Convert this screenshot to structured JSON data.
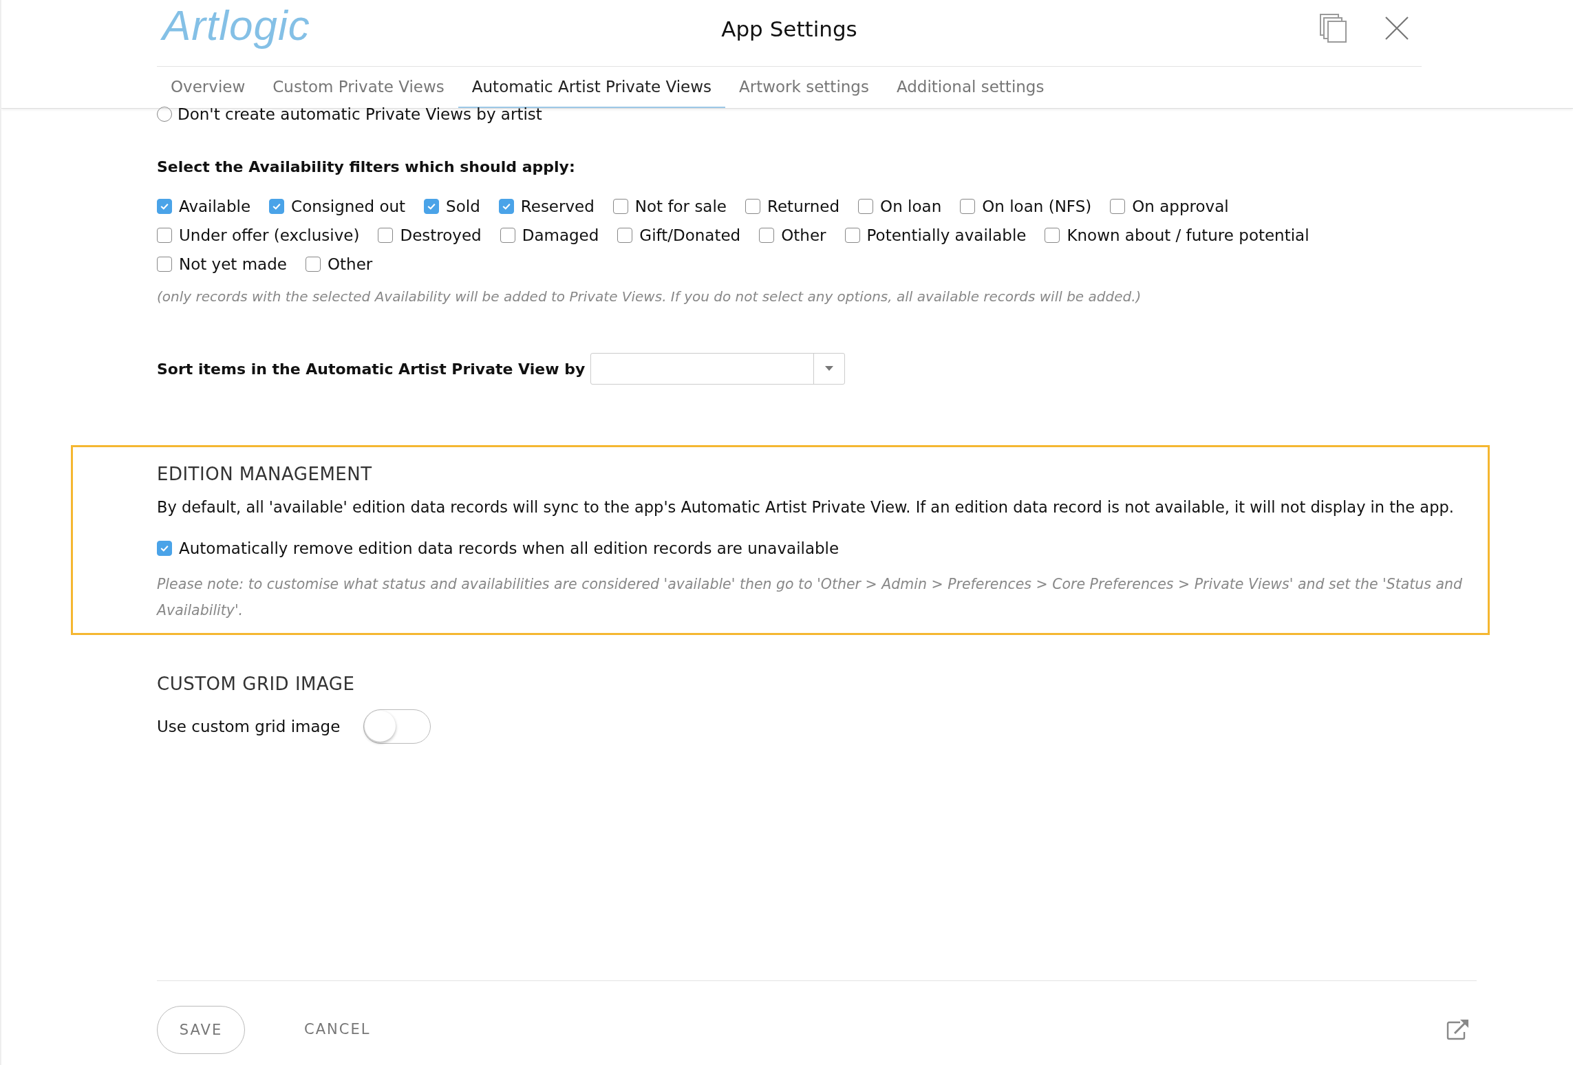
{
  "header": {
    "logo": "Artlogic",
    "title": "App Settings"
  },
  "tabs": [
    {
      "label": "Overview",
      "selected": false
    },
    {
      "label": "Custom Private Views",
      "selected": false
    },
    {
      "label": "Automatic Artist Private Views",
      "selected": true
    },
    {
      "label": "Artwork settings",
      "selected": false
    },
    {
      "label": "Additional settings",
      "selected": false
    }
  ],
  "radio_option": {
    "label": "Don't create automatic Private Views by artist",
    "selected": false
  },
  "availability": {
    "heading": "Select the Availability filters which should apply:",
    "filters": [
      {
        "label": "Available",
        "checked": true
      },
      {
        "label": "Consigned out",
        "checked": true
      },
      {
        "label": "Sold",
        "checked": true
      },
      {
        "label": "Reserved",
        "checked": true
      },
      {
        "label": "Not for sale",
        "checked": false
      },
      {
        "label": "Returned",
        "checked": false
      },
      {
        "label": "On loan",
        "checked": false
      },
      {
        "label": "On loan (NFS)",
        "checked": false
      },
      {
        "label": "On approval",
        "checked": false
      },
      {
        "label": "Under offer (exclusive)",
        "checked": false
      },
      {
        "label": "Destroyed",
        "checked": false
      },
      {
        "label": "Damaged",
        "checked": false
      },
      {
        "label": "Gift/Donated",
        "checked": false
      },
      {
        "label": "Other",
        "checked": false
      },
      {
        "label": "Potentially available",
        "checked": false
      },
      {
        "label": "Known about / future potential",
        "checked": false
      },
      {
        "label": "Not yet made",
        "checked": false
      },
      {
        "label": "Other",
        "checked": false
      }
    ],
    "note": "(only records with the selected Availability will be added to Private Views. If you do not select any options, all available records will be added.)"
  },
  "sort": {
    "label": "Sort items in the Automatic Artist Private View by"
  },
  "edition_management": {
    "heading": "EDITION MANAGEMENT",
    "description": "By default, all 'available' edition data records will sync to the app's Automatic Artist Private View. If an edition data record is not available, it will not display in the app.",
    "option": {
      "label": "Automatically remove edition data records when all edition records are unavailable",
      "checked": true
    },
    "note": "Please note: to customise what status and availabilities are considered 'available' then go to 'Other > Admin > Preferences > Core Preferences > Private Views' and set the 'Status and Availability'."
  },
  "custom_grid_image": {
    "heading": "CUSTOM GRID IMAGE",
    "label": "Use custom grid image",
    "on": false
  },
  "buttons": {
    "save": "SAVE",
    "cancel": "CANCEL"
  }
}
